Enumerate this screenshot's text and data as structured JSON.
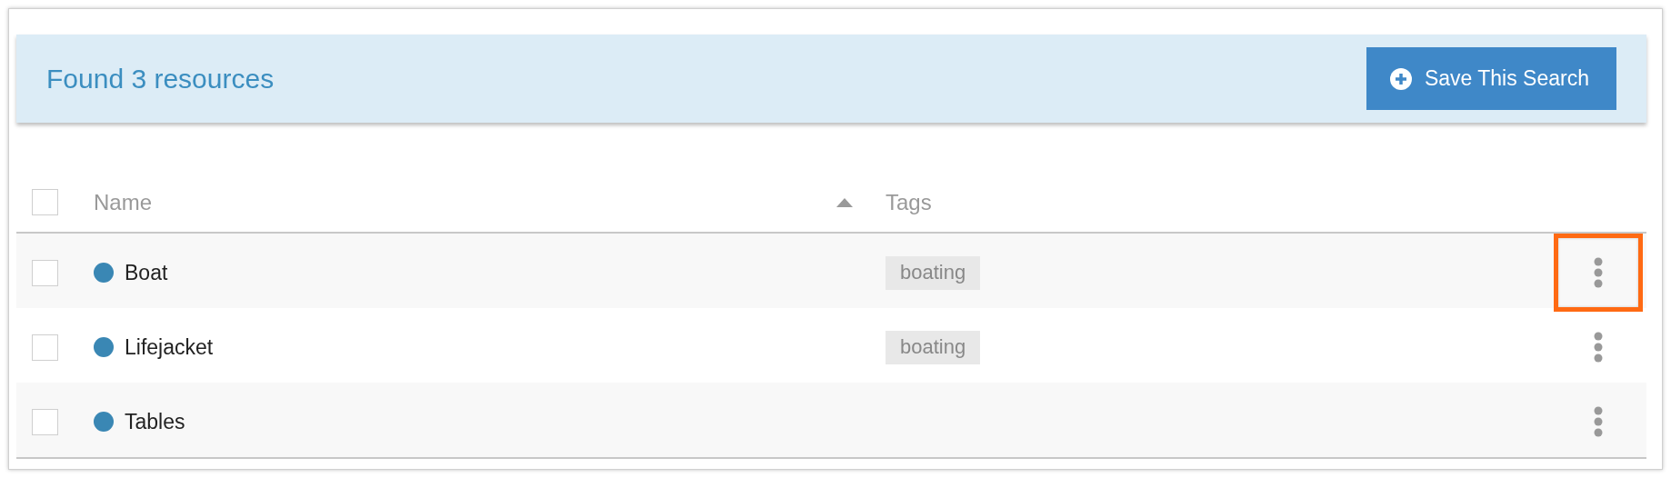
{
  "banner": {
    "title": "Found 3 resources",
    "save_button": "Save This Search"
  },
  "table": {
    "header": {
      "checked": false,
      "columns": [
        {
          "label": "Name",
          "sorted": true
        },
        {
          "label": "Tags",
          "sorted": false
        }
      ]
    },
    "rows": [
      {
        "checked": false,
        "color": "#3a87b4",
        "name": "Boat",
        "tags": [
          "boating"
        ],
        "highlighted": true
      },
      {
        "checked": false,
        "color": "#3a87b4",
        "name": "Lifejacket",
        "tags": [
          "boating"
        ],
        "highlighted": false
      },
      {
        "checked": false,
        "color": "#3a87b4",
        "name": "Tables",
        "highlighted": false
      }
    ]
  }
}
